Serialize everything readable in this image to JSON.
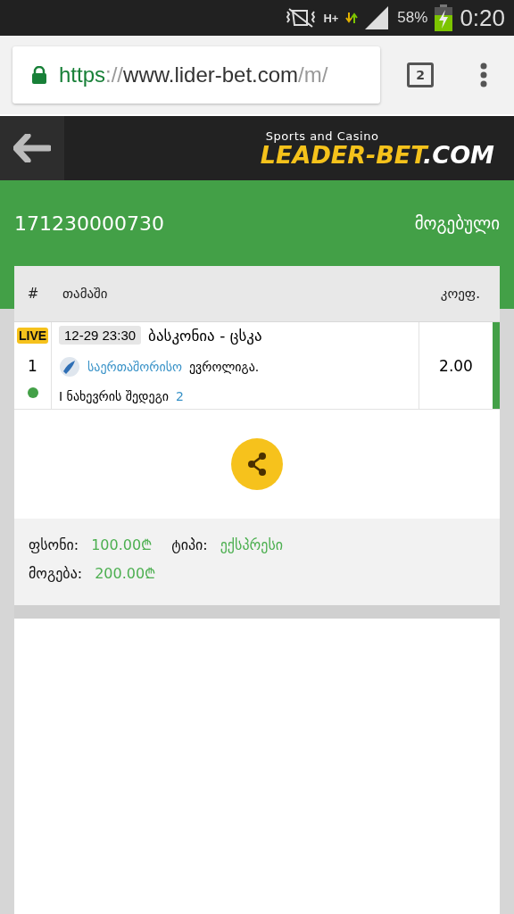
{
  "status_bar": {
    "network": "H+",
    "battery": "58%",
    "time": "0:20"
  },
  "browser": {
    "url_scheme": "https",
    "url_sep": "://",
    "url_host": "www.lider-bet.com",
    "url_path": "/m/",
    "tab_count": "2"
  },
  "header": {
    "tagline": "Sports and Casino",
    "logo_main": "LEADER-BET",
    "logo_suffix": ".COM"
  },
  "ticket": {
    "number": "171230000730",
    "status": "მოგებული"
  },
  "table": {
    "columns": [
      "#",
      "თამაში",
      "კოეფ."
    ],
    "rows": [
      {
        "live": "LIVE",
        "index": "1",
        "date": "12-29 23:30",
        "match": "ბასკონია - ცსკა",
        "category": "საერთაშორისო",
        "league": "ევროლიგა.",
        "market": "I ნახევრის შედეგი",
        "pick": "2",
        "odds": "2.00",
        "color": "#43a047"
      }
    ]
  },
  "summary": {
    "stake_label": "ფსონი:",
    "stake": "100.00₾",
    "type_label": "ტიპი:",
    "type": "ექსპრესი",
    "win_label": "მოგება:",
    "win": "200.00₾"
  }
}
